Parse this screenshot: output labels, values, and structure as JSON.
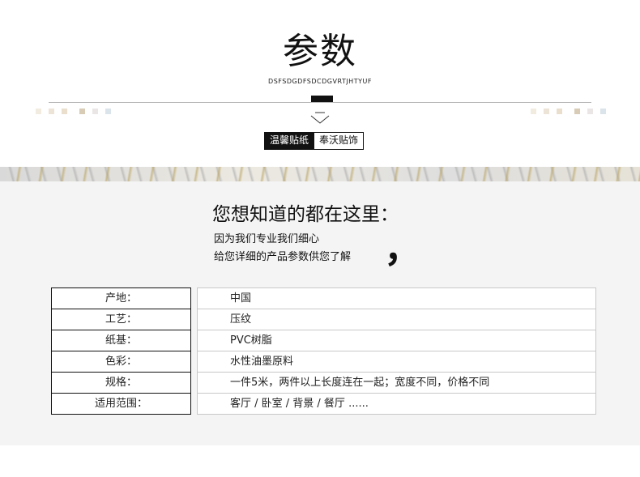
{
  "header": {
    "title": "参数",
    "subtitle": "DSFSDGDFSDCDGVRTJHTYUF",
    "tag_primary": "温馨贴纸",
    "tag_secondary": "奉沃贴饰",
    "decor_colors_left": [
      "#f2ece0",
      "#ece4d6",
      "#e9dfcc",
      "#d8ccb6",
      "#ebe6e6",
      "#dbe4ea"
    ],
    "decor_colors_right": [
      "#f2ece0",
      "#ece4d6",
      "#e9dfcc",
      "#d8ccb6",
      "#ebe6e6",
      "#dbe4ea"
    ]
  },
  "intro": {
    "heading": "您想知道的都在这里：",
    "line1": "因为我们专业我们细心",
    "line2": "给您详细的产品参数供您了解",
    "comma": "，"
  },
  "params": [
    {
      "label": "产地：",
      "value": "中国"
    },
    {
      "label": "工艺：",
      "value": "压纹"
    },
    {
      "label": "纸基：",
      "value": "PVC树脂"
    },
    {
      "label": "色彩：",
      "value": "水性油墨原料"
    },
    {
      "label": "规格：",
      "value": "一件5米，两件以上长度连在一起；宽度不同，价格不同"
    },
    {
      "label": "适用范围：",
      "value": "客厅 / 卧室 / 背景 / 餐厅 ......"
    }
  ]
}
